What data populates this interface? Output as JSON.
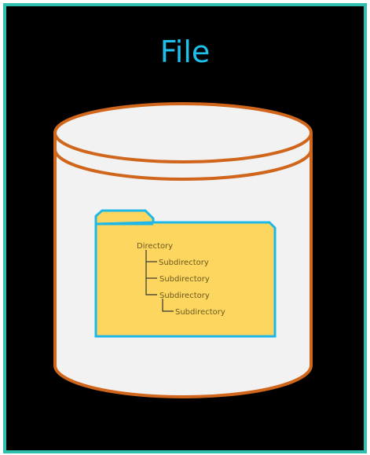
{
  "title": "File",
  "colors": {
    "border": "#2fbfae",
    "title": "#1ec0ec",
    "cylinder_stroke": "#d0651c",
    "cylinder_fill": "#f2f2f2",
    "folder_fill": "#fdd660",
    "folder_stroke": "#1db8e8"
  },
  "tree": {
    "root": "Directory",
    "children": [
      "Subdirectory",
      "Subdirectory",
      "Subdirectory"
    ],
    "grandchild": "Subdirectory"
  }
}
